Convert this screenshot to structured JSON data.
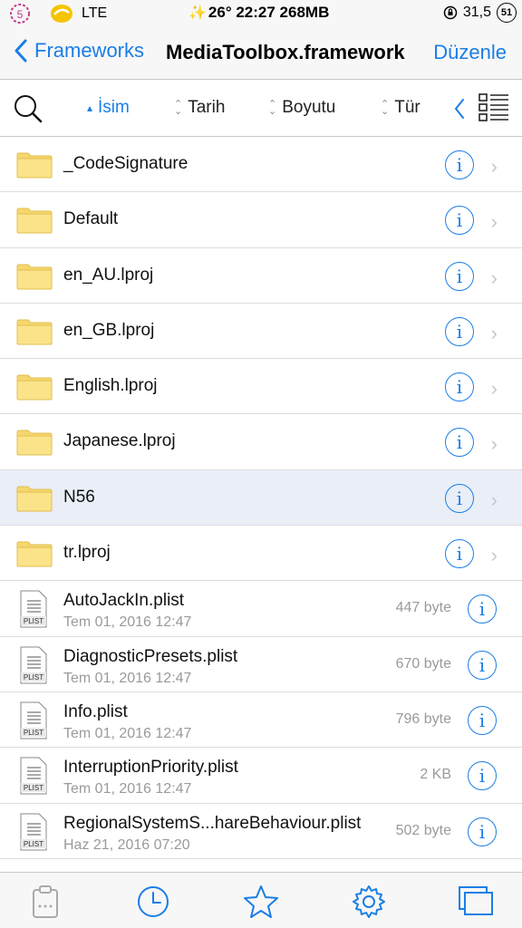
{
  "status_bar": {
    "carrier_badge": "5",
    "network": "LTE",
    "center_text": "26° 22:27 268MB",
    "signal": "31,5",
    "battery": "51"
  },
  "nav": {
    "back_label": "Frameworks",
    "title": "MediaToolbox.framework",
    "edit_label": "Düzenle"
  },
  "sort": {
    "name": "İsim",
    "date": "Tarih",
    "size": "Boyutu",
    "type": "Tür"
  },
  "folders": [
    {
      "name": "_CodeSignature"
    },
    {
      "name": "Default"
    },
    {
      "name": "en_AU.lproj"
    },
    {
      "name": "en_GB.lproj"
    },
    {
      "name": "English.lproj"
    },
    {
      "name": "Japanese.lproj"
    },
    {
      "name": "N56"
    },
    {
      "name": "tr.lproj"
    }
  ],
  "files": [
    {
      "name": "AutoJackIn.plist",
      "date": "Tem 01, 2016 12:47",
      "size": "447 byte"
    },
    {
      "name": "DiagnosticPresets.plist",
      "date": "Tem 01, 2016 12:47",
      "size": "670 byte"
    },
    {
      "name": "Info.plist",
      "date": "Tem 01, 2016 12:47",
      "size": "796 byte"
    },
    {
      "name": "InterruptionPriority.plist",
      "date": "Tem 01, 2016 12:47",
      "size": "2 KB"
    },
    {
      "name": "RegionalSystemS...hareBehaviour.plist",
      "date": "Haz 21, 2016 07:20",
      "size": "502 byte"
    }
  ],
  "file_type_label": "PLIST",
  "info_glyph": "i",
  "chevron_glyph": "›",
  "selected_row": "N56",
  "accent_color": "#1a7ee6",
  "tabs": [
    "clipboard-icon",
    "clock-icon",
    "star-icon",
    "gear-icon",
    "windows-icon"
  ]
}
